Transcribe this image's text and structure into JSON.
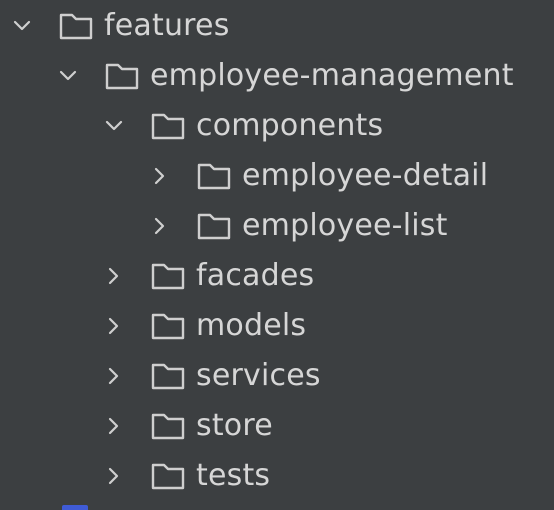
{
  "tree": {
    "rows": [
      {
        "label": "features",
        "depth": 0,
        "expanded": true
      },
      {
        "label": "employee-management",
        "depth": 1,
        "expanded": true
      },
      {
        "label": "components",
        "depth": 2,
        "expanded": true
      },
      {
        "label": "employee-detail",
        "depth": 3,
        "expanded": false
      },
      {
        "label": "employee-list",
        "depth": 3,
        "expanded": false
      },
      {
        "label": "facades",
        "depth": 2,
        "expanded": false
      },
      {
        "label": "models",
        "depth": 2,
        "expanded": false
      },
      {
        "label": "services",
        "depth": 2,
        "expanded": false
      },
      {
        "label": "store",
        "depth": 2,
        "expanded": false
      },
      {
        "label": "tests",
        "depth": 2,
        "expanded": false
      }
    ]
  },
  "colors": {
    "background": "#3c3f41",
    "text": "#d6d6d6",
    "icon": "#cfcfcf",
    "scroll_accent": "#3f5bd6"
  },
  "icons": {
    "expanded": "chevron-down-icon",
    "collapsed": "chevron-right-icon",
    "folder": "folder-icon"
  }
}
